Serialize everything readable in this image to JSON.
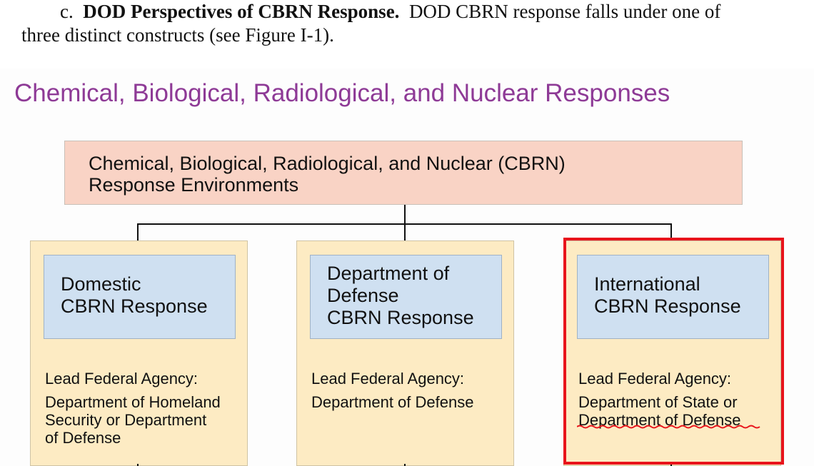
{
  "document": {
    "prefix": "c.",
    "heading": "DOD Perspectives of CBRN Response.",
    "body_line1": "DOD CBRN response falls under one of",
    "body_line2": "three distinct constructs (see Figure I-1)."
  },
  "figure": {
    "title": "Chemical, Biological, Radiological, and Nuclear Responses",
    "root": {
      "line1": "Chemical, Biological, Radiological, and Nuclear (CBRN)",
      "line2": "Response Environments"
    },
    "columns": [
      {
        "title_lines": [
          "Domestic",
          "CBRN Response"
        ],
        "lead_label": "Lead Federal Agency:",
        "lead_lines": [
          "Department of Homeland",
          "Security or Department",
          "of Defense"
        ]
      },
      {
        "title_lines": [
          "Department of",
          "Defense",
          "CBRN Response"
        ],
        "lead_label": "Lead Federal Agency:",
        "lead_lines": [
          "Department of Defense"
        ]
      },
      {
        "title_lines": [
          "International",
          "CBRN Response"
        ],
        "lead_label": "Lead Federal Agency:",
        "lead_lines": [
          "Department of State or",
          "Department of Defense"
        ]
      }
    ]
  },
  "colors": {
    "title": "#8e3a96",
    "root_fill": "#f9d3c5",
    "column_fill": "#fdebc3",
    "inner_fill": "#cfe0f1",
    "highlight_border": "#e8141b"
  }
}
